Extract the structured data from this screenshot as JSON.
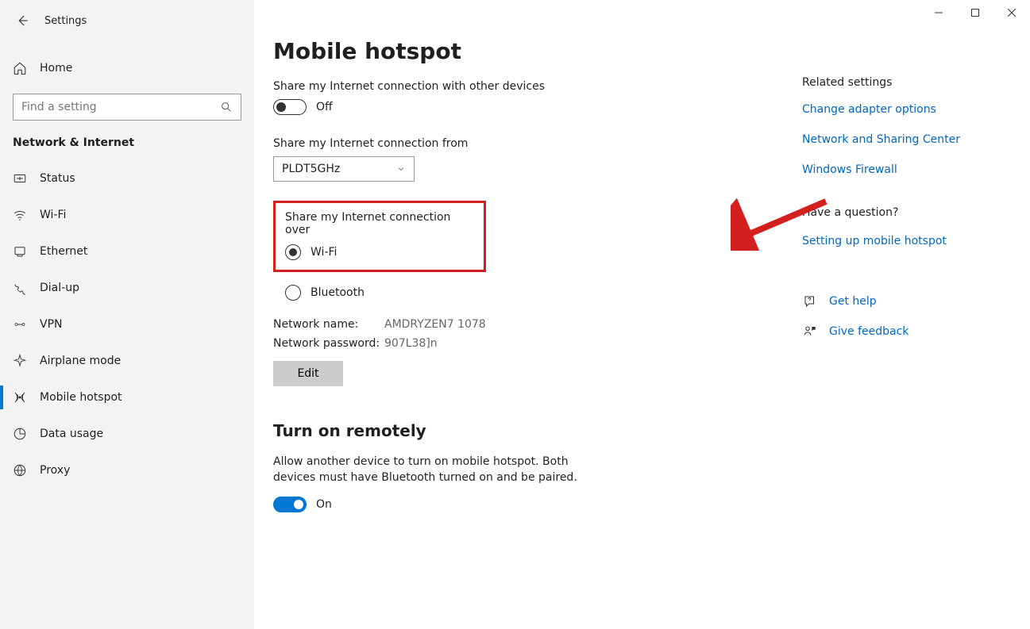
{
  "app": {
    "title": "Settings"
  },
  "sidebar": {
    "home_label": "Home",
    "search_placeholder": "Find a setting",
    "category_label": "Network & Internet",
    "items": [
      {
        "label": "Status"
      },
      {
        "label": "Wi-Fi"
      },
      {
        "label": "Ethernet"
      },
      {
        "label": "Dial-up"
      },
      {
        "label": "VPN"
      },
      {
        "label": "Airplane mode"
      },
      {
        "label": "Mobile hotspot"
      },
      {
        "label": "Data usage"
      },
      {
        "label": "Proxy"
      }
    ]
  },
  "main": {
    "page_title": "Mobile hotspot",
    "share_label": "Share my Internet connection with other devices",
    "share_toggle_text": "Off",
    "from_label": "Share my Internet connection from",
    "from_value": "PLDT5GHz",
    "over_label": "Share my Internet connection over",
    "over_options": {
      "wifi": "Wi-Fi",
      "bluetooth": "Bluetooth"
    },
    "network_name_label": "Network name:",
    "network_name_value": "AMDRYZEN7 1078",
    "network_password_label": "Network password:",
    "network_password_value": "907L38]n",
    "edit_label": "Edit",
    "remote_heading": "Turn on remotely",
    "remote_desc": "Allow another device to turn on mobile hotspot. Both devices must have Bluetooth turned on and be paired.",
    "remote_toggle_text": "On"
  },
  "right": {
    "related_title": "Related settings",
    "links": [
      "Change adapter options",
      "Network and Sharing Center",
      "Windows Firewall"
    ],
    "question_title": "Have a question?",
    "question_link": "Setting up mobile hotspot",
    "get_help": "Get help",
    "give_feedback": "Give feedback"
  }
}
